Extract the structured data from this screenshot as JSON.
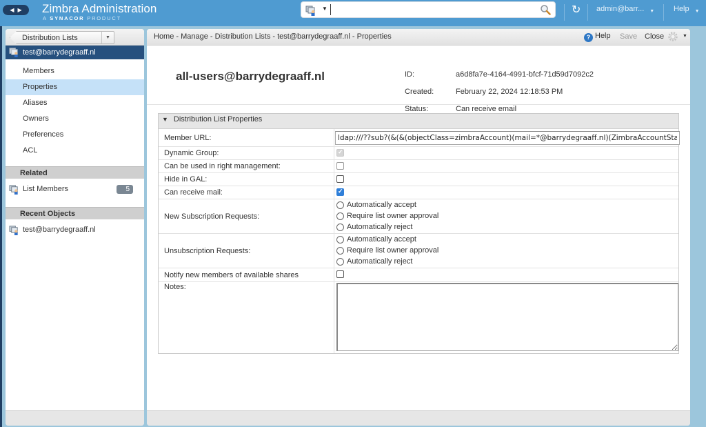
{
  "header": {
    "app_title": "Zimbra Administration",
    "app_subtitle_prefix": "A",
    "app_subtitle_brand": "SYNACOR",
    "app_subtitle_suffix": "PRODUCT",
    "search": {
      "value": "",
      "placeholder": ""
    },
    "user_menu": "admin@barr...",
    "help_menu": "Help",
    "icons": {
      "nav_back": "◀",
      "nav_forward": "▶",
      "refresh": "↻",
      "caret": "▼"
    }
  },
  "left_panel": {
    "back_button_label": "Distribution Lists",
    "current_item": "test@barrydegraaff.nl",
    "nav_items": [
      {
        "label": "Members",
        "selected": false
      },
      {
        "label": "Properties",
        "selected": true
      },
      {
        "label": "Aliases",
        "selected": false
      },
      {
        "label": "Owners",
        "selected": false
      },
      {
        "label": "Preferences",
        "selected": false
      },
      {
        "label": "ACL",
        "selected": false
      }
    ],
    "related_header": "Related",
    "related_items": [
      {
        "label": "List Members",
        "count": "5"
      }
    ],
    "recent_header": "Recent Objects",
    "recent_items": [
      {
        "label": "test@barrydegraaff.nl"
      }
    ]
  },
  "main": {
    "breadcrumb": "Home - Manage - Distribution Lists - test@barrydegraaff.nl - Properties",
    "toolbar": {
      "help": "Help",
      "save": "Save",
      "close": "Close"
    },
    "summary": {
      "title": "all-users@barrydegraaff.nl",
      "id_label": "ID:",
      "id_value": "a6d8fa7e-4164-4991-bfcf-71d59d7092c2",
      "created_label": "Created:",
      "created_value": "February 22, 2024 12:18:53 PM",
      "status_label": "Status:",
      "status_value": "Can receive email"
    },
    "properties": {
      "section_title": "Distribution List Properties",
      "member_url_label": "Member URL:",
      "member_url_value": "ldap:///??sub?(&(&(objectClass=zimbraAccount)(mail=*@barrydegraaff.nl)(ZimbraAccountStatus=active)))",
      "dynamic_group_label": "Dynamic Group:",
      "dynamic_group_checked": true,
      "right_mgmt_label": "Can be used in right management:",
      "right_mgmt_checked": false,
      "hide_gal_label": "Hide in GAL:",
      "hide_gal_checked": false,
      "receive_mail_label": "Can receive mail:",
      "receive_mail_checked": true,
      "new_sub_label": "New Subscription Requests:",
      "new_sub_options": [
        "Automatically accept",
        "Require list owner approval",
        "Automatically reject"
      ],
      "unsub_label": "Unsubscription Requests:",
      "unsub_options": [
        "Automatically accept",
        "Require list owner approval",
        "Automatically reject"
      ],
      "notify_label": "Notify new members of available shares",
      "notify_checked": false,
      "notes_label": "Notes:",
      "notes_value": ""
    }
  }
}
